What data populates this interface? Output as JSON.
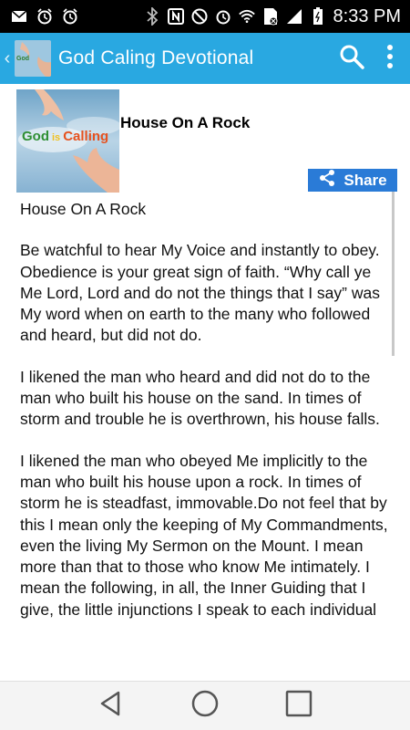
{
  "status_bar": {
    "time": "8:33 PM",
    "icons_left": [
      "mail-icon",
      "alarm-icon",
      "alarm-icon",
      "bluetooth-icon"
    ],
    "icons_right": [
      "nfc-icon",
      "mute-icon",
      "alarm-icon",
      "wifi-icon",
      "sim-icon",
      "signal-icon",
      "battery-icon"
    ]
  },
  "app_bar": {
    "title": "God Caling Devotional",
    "background": "#29a8e1"
  },
  "entry": {
    "title": "House On A Rock",
    "share_label": "Share",
    "image_text": {
      "word1": "God",
      "word2": "is",
      "word3": "Calling"
    }
  },
  "body": {
    "paragraphs": [
      "House On A Rock",
      "Be watchful to hear My Voice and instantly to obey. Obedience is your great sign of faith. “Why call ye Me Lord, Lord and do not the things that I say” was My word when on earth to the many who followed and heard, but did not do.",
      "I likened the man who heard and did not do to the man who built his house on the sand.  In times of storm and trouble he is overthrown, his house falls.",
      "I likened the man who obeyed Me implicitly to the man who built his house upon a rock.  In times of storm he is steadfast, immovable.Do not feel that by this I mean only the keeping of My Commandments, even the living My Sermon on the Mount.  I mean more than that to those who know Me intimately.  I mean the following, in all, the Inner Guiding that I give, the little injunctions I speak to each individual"
    ]
  },
  "colors": {
    "share_button": "#2a7bd7",
    "status_bar": "#000000",
    "nav_bar": "#f4f4f4"
  }
}
